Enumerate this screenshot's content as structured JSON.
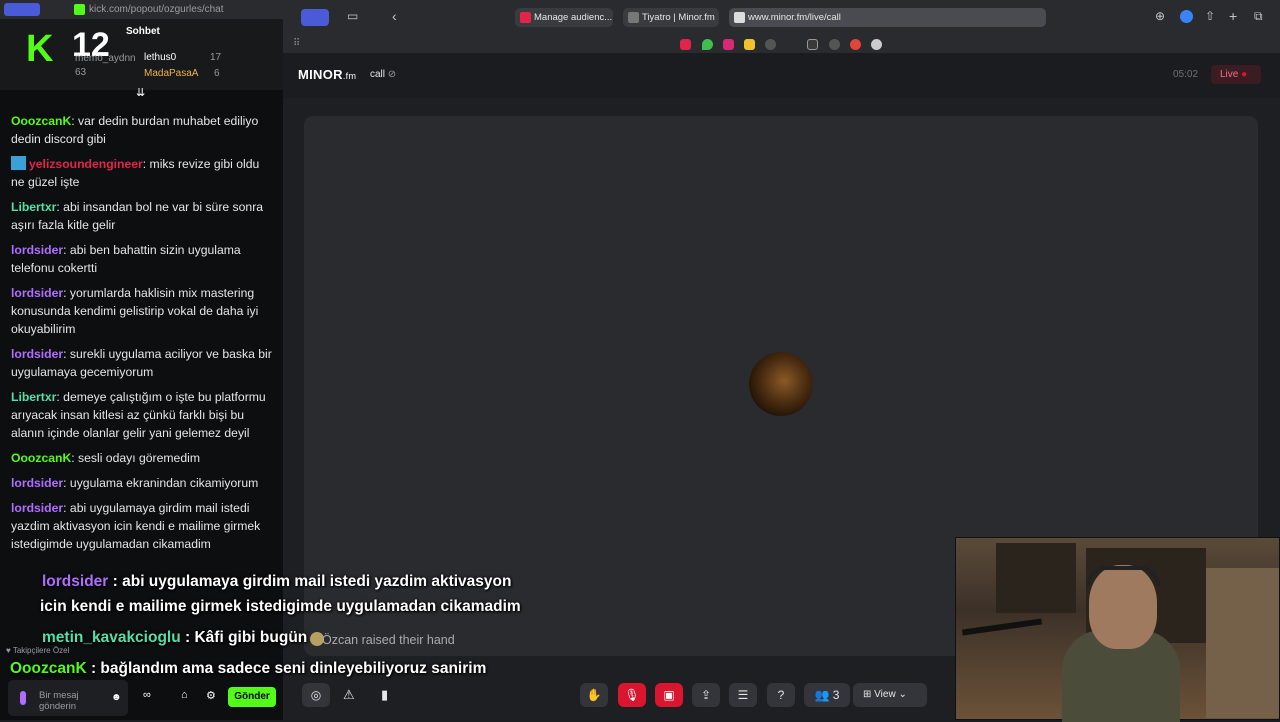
{
  "chat_window": {
    "url": "kick.com/popout/ozgurles/chat",
    "title": "Sohbet",
    "logo_letter": "K",
    "logo_number": "12",
    "leaderboard": [
      {
        "name": "memo_aydnn",
        "score": "63"
      },
      {
        "name": "lethus0",
        "score": "17"
      },
      {
        "name": "MadaPasaA",
        "score": "6"
      }
    ],
    "messages": [
      {
        "user": "OoozcanK",
        "text": ": var dedin burdan muhabet ediliyo dedin discord gibi"
      },
      {
        "user": "yelizsoundengineer",
        "text": ": miks revize gibi oldu ne güzel işte"
      },
      {
        "user": "Libertxr",
        "text": ": abi insandan bol ne var bi süre sonra aşırı fazla kitle gelir"
      },
      {
        "user": "lordsider",
        "text": ": abi ben bahattin sizin uygulama telefonu cokertti"
      },
      {
        "user": "lordsider",
        "text": ": yorumlarda haklisin mix mastering konusunda kendimi gelistirip vokal de daha iyi okuyabilirim"
      },
      {
        "user": "lordsider",
        "text": ": surekli uygulama aciliyor ve baska bir uygulamaya gecemiyorum"
      },
      {
        "user": "Libertxr",
        "text": ": demeye çalıştığım o işte bu platformu arıyacak insan kitlesi az çünkü farklı bişi bu alanın içinde olanlar gelir yani gelemez deyil"
      },
      {
        "user": "OoozcanK",
        "text": ": sesli odayı göremedim"
      },
      {
        "user": "lordsider",
        "text": ": uygulama ekranindan cikamiyorum"
      },
      {
        "user": "lordsider",
        "text": ": abi uygulamaya girdim mail istedi yazdim aktivasyon icin kendi e mailime girmek istedigimde uygulamadan cikamadim"
      }
    ],
    "followers_label": "Takipçilere Özel",
    "input_placeholder": "Bir mesaj gönderin",
    "send_label": "Gönder"
  },
  "overlay": {
    "line1_user": "lordsider",
    "line1_text": " : abi uygulamaya girdim mail istedi yazdim aktivasyon",
    "line2_text": "icin kendi e mailime girmek istedigimde uygulamadan cikamadim",
    "line3_user": "metin_kavakcioglu",
    "line3_text": " : Kâfi gibi bugün",
    "line4_user": "OoozcanK",
    "line4_text": " : bağlandım ama sadece seni dinleyebiliyoruz sanirim"
  },
  "browser": {
    "tabs": [
      {
        "label": "Manage audienc...",
        "icon_color": "#e0244a"
      },
      {
        "label": "Tiyatro | Minor.fm",
        "icon_color": "#777"
      },
      {
        "label": "www.minor.fm/live/call",
        "icon_color": "#ddd"
      }
    ]
  },
  "app": {
    "logo": "MINOR",
    "logo_suffix": ".fm",
    "call_label": "call",
    "timer": "05:02",
    "live_label": "Live",
    "raised_hand_text": "Özcan raised their hand",
    "participants_count": "3",
    "view_label": "View"
  }
}
